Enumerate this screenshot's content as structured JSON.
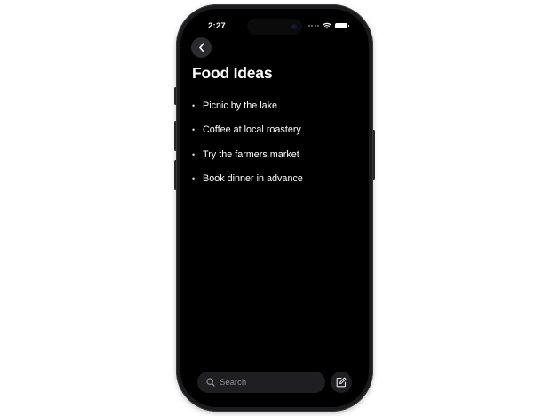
{
  "status_bar": {
    "time": "2:27"
  },
  "note": {
    "title": "Food Ideas",
    "bullet_glyph": "•",
    "items": [
      "Picnic by the lake",
      "Coffee at local roastery",
      "Try the farmers market",
      "Book dinner in advance"
    ]
  },
  "toolbar": {
    "search_placeholder": "Search"
  },
  "icons": {
    "back": "chevron-left-icon",
    "search": "search-icon",
    "compose": "compose-icon",
    "wifi": "wifi-icon",
    "battery": "battery-icon"
  },
  "colors": {
    "screen_bg": "#000000",
    "frame": "#1b1b1d",
    "control_bg": "#2b2b2d"
  }
}
